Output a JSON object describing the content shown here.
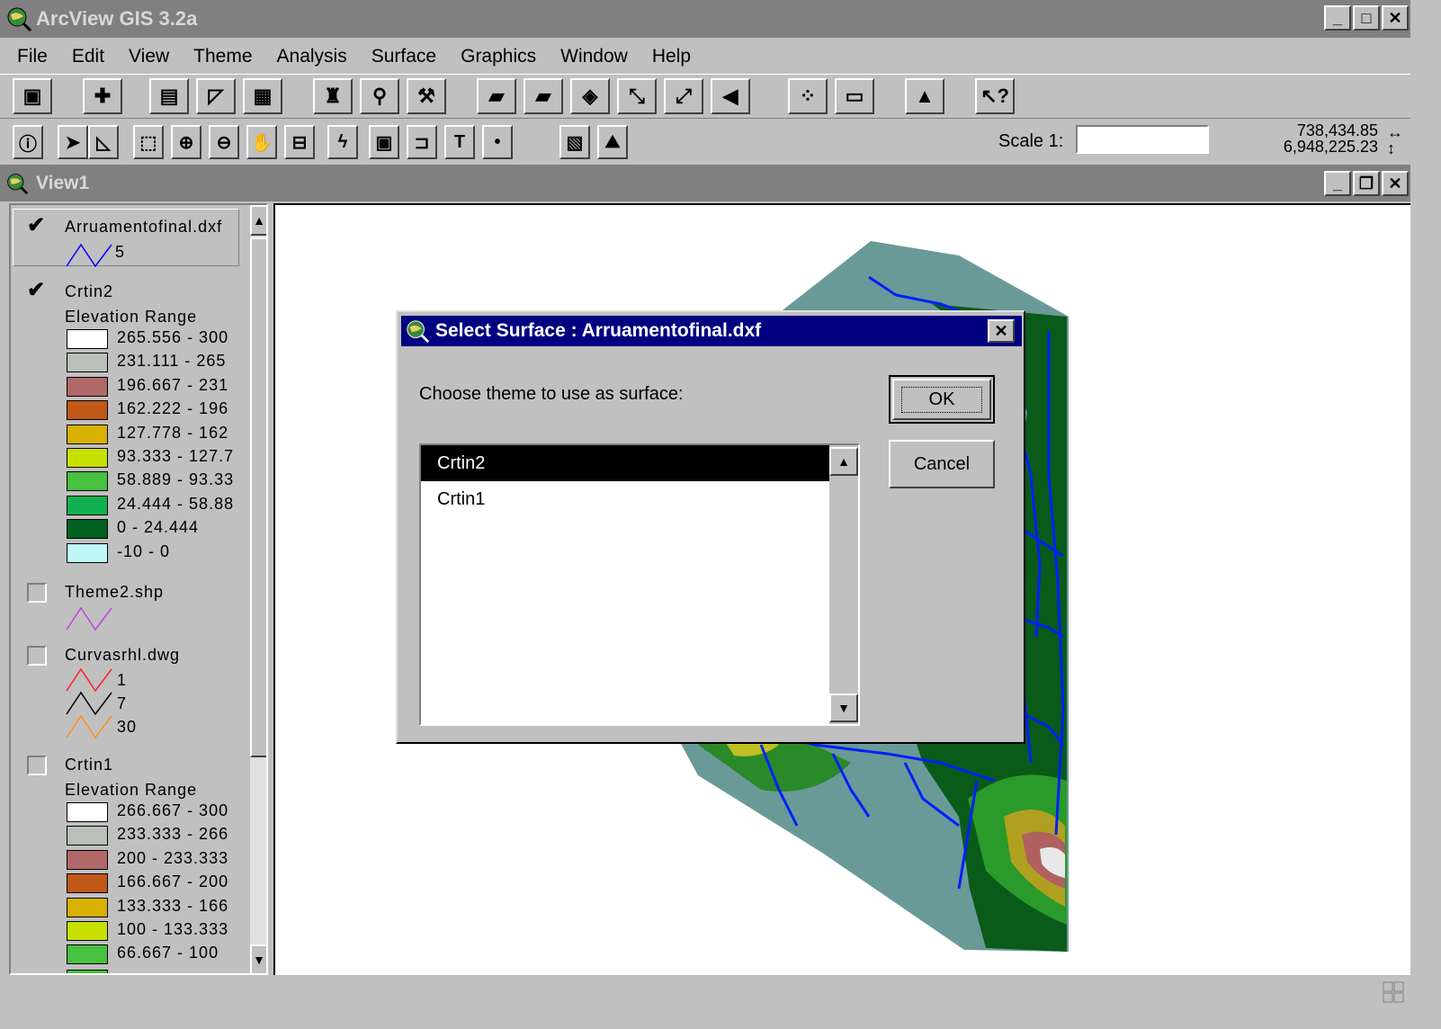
{
  "app": {
    "title": "ArcView GIS 3.2a"
  },
  "menu": [
    "File",
    "Edit",
    "View",
    "Theme",
    "Analysis",
    "Surface",
    "Graphics",
    "Window",
    "Help"
  ],
  "scale": {
    "label": "Scale 1:",
    "value": ""
  },
  "coords": {
    "x": "738,434.85",
    "y": "6,948,225.23"
  },
  "view": {
    "title": "View1"
  },
  "toc": {
    "themes": [
      {
        "name": "Arruamentofinal.dxf",
        "checked": true,
        "legend": [
          {
            "label": "5",
            "color": "#0000ff"
          }
        ]
      },
      {
        "name": "Crtin2",
        "checked": true,
        "subtitle": "Elevation Range",
        "legend": [
          {
            "label": "265.556 - 300",
            "color": "#ffffff"
          },
          {
            "label": "231.111 - 265",
            "color": "#b8c0b8"
          },
          {
            "label": "196.667 - 231",
            "color": "#b06868"
          },
          {
            "label": "162.222 - 196",
            "color": "#c05818"
          },
          {
            "label": "127.778 - 162",
            "color": "#d8b000"
          },
          {
            "label": "93.333 - 127.7",
            "color": "#c8e000"
          },
          {
            "label": "58.889 - 93.33",
            "color": "#48c040"
          },
          {
            "label": "24.444 - 58.88",
            "color": "#10b050"
          },
          {
            "label": "0 - 24.444",
            "color": "#006020"
          },
          {
            "label": "-10 - 0",
            "color": "#c0f8f8"
          }
        ]
      },
      {
        "name": "Theme2.shp",
        "checked": false,
        "legend": [
          {
            "label": "",
            "color": "#c040e0"
          }
        ]
      },
      {
        "name": "Curvasrhl.dwg",
        "checked": false,
        "legend": [
          {
            "label": "1",
            "color": "#ff2020"
          },
          {
            "label": "7",
            "color": "#000000"
          },
          {
            "label": "30",
            "color": "#ff9020"
          }
        ]
      },
      {
        "name": "Crtin1",
        "checked": false,
        "subtitle": "Elevation Range",
        "legend": [
          {
            "label": "266.667 - 300",
            "color": "#ffffff"
          },
          {
            "label": "233.333 - 266",
            "color": "#b8c0b8"
          },
          {
            "label": "200 - 233.333",
            "color": "#b06868"
          },
          {
            "label": "166.667 - 200",
            "color": "#c05818"
          },
          {
            "label": "133.333 - 166",
            "color": "#d8b000"
          },
          {
            "label": "100 - 133.333",
            "color": "#c8e000"
          },
          {
            "label": "66.667 - 100",
            "color": "#48c040"
          }
        ]
      }
    ]
  },
  "dialog": {
    "title": "Select Surface : Arruamentofinal.dxf",
    "prompt": "Choose theme to use as surface:",
    "ok": "OK",
    "cancel": "Cancel",
    "items": [
      {
        "label": "Crtin2",
        "selected": true
      },
      {
        "label": "Crtin1",
        "selected": false
      }
    ]
  }
}
